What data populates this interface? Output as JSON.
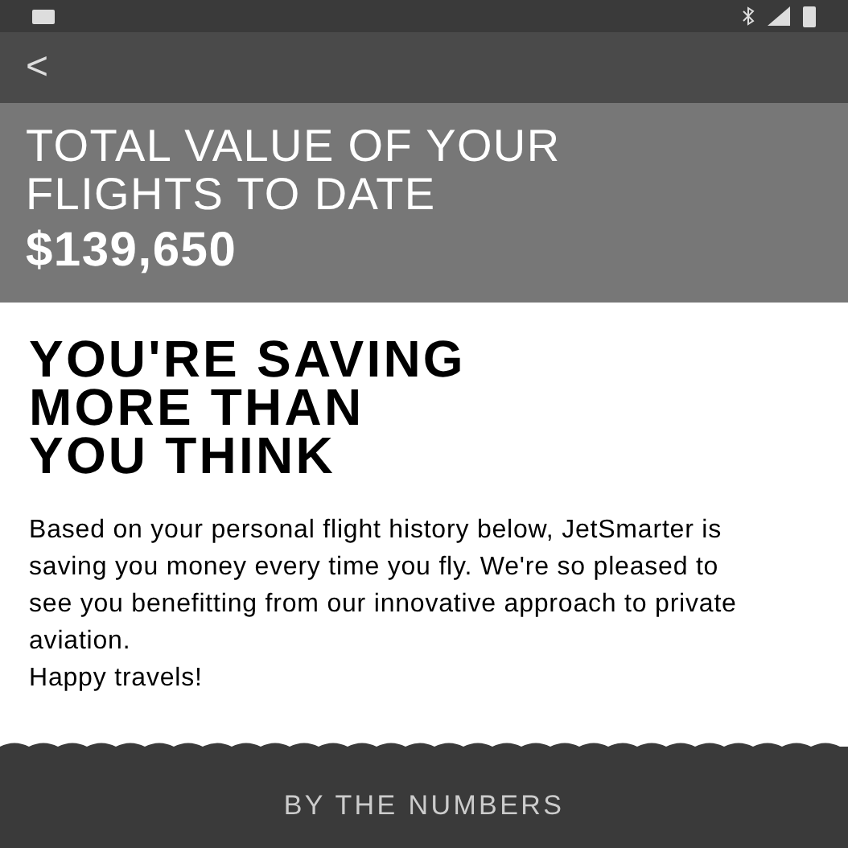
{
  "app_bar": {
    "back": "<"
  },
  "summary": {
    "label": "TOTAL VALUE OF YOUR FLIGHTS TO DATE",
    "value": "$139,650"
  },
  "savings": {
    "heading": "YOU'RE SAVING MORE THAN YOU THINK",
    "body": "Based on your personal flight history below, JetSmarter is saving you money every time you fly. We're so pleased to see you benefitting from our innovative approach to private aviation.",
    "sign_off": "Happy travels!"
  },
  "section": {
    "title": "BY THE NUMBERS"
  }
}
